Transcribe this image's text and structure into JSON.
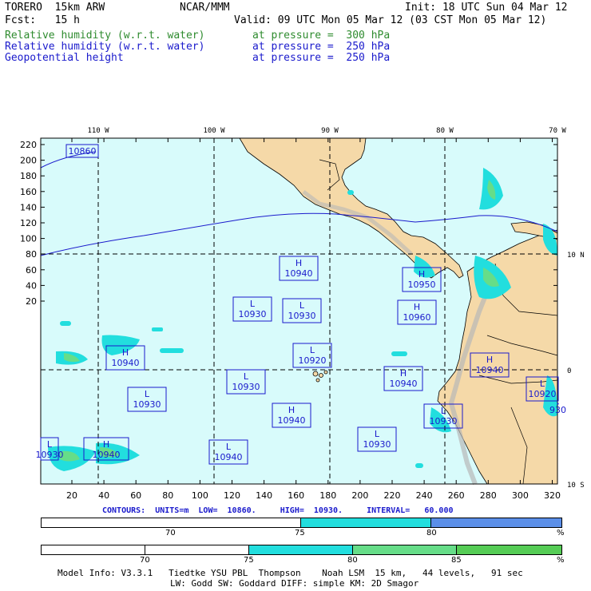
{
  "header": {
    "left1": "TORERO  15km ARW",
    "center1": "NCAR/MMM",
    "right1": "Init: 18 UTC Sun 04 Mar 12",
    "left2": "Fcst:   15 h",
    "right2": "Valid: 09 UTC Mon 05 Mar 12 (03 CST Mon 05 Mar 12)",
    "fields": [
      {
        "name": "Relative humidity (w.r.t. water)",
        "level": "at pressure =  300 hPa",
        "color": "#2e8b2e"
      },
      {
        "name": "Relative humidity (w.r.t. water)",
        "level": "at pressure =  250 hPa",
        "color": "#1a1acc"
      },
      {
        "name": "Geopotential height",
        "level": "at pressure =  250 hPa",
        "color": "#1a1acc"
      }
    ]
  },
  "map": {
    "top_lon_labels": [
      "110 W",
      "100 W",
      "90 W",
      "80 W",
      "70 W"
    ],
    "right_lat_labels": [
      "10 N",
      "0",
      "10 S"
    ],
    "y_ticks": [
      "220",
      "200",
      "180",
      "160",
      "140",
      "120",
      "100",
      "80",
      "60",
      "40",
      "20"
    ],
    "x_ticks": [
      "20",
      "40",
      "60",
      "80",
      "100",
      "120",
      "140",
      "160",
      "180",
      "200",
      "220",
      "240",
      "260",
      "280",
      "300",
      "320"
    ],
    "centers": [
      {
        "type": "",
        "value": "10860"
      },
      {
        "type": "H",
        "value": "10940"
      },
      {
        "type": "H",
        "value": "10940"
      },
      {
        "type": "L",
        "value": "10930"
      },
      {
        "type": "H",
        "value": "10950"
      },
      {
        "type": "H",
        "value": "10960"
      },
      {
        "type": "H",
        "value": "10940"
      },
      {
        "type": "L",
        "value": "10930"
      },
      {
        "type": "L",
        "value": "10930"
      },
      {
        "type": "L",
        "value": "10920"
      },
      {
        "type": "H",
        "value": "10940"
      },
      {
        "type": "L",
        "value": "10930"
      },
      {
        "type": "L",
        "value": "10930"
      },
      {
        "type": "H",
        "value": "10940"
      },
      {
        "type": "L",
        "value": "10930"
      },
      {
        "type": "L",
        "value": "10930"
      },
      {
        "type": "L",
        "value": "10940"
      },
      {
        "type": "H",
        "value": "10940"
      },
      {
        "type": "L",
        "value": "10920"
      },
      {
        "type": "",
        "value": "930"
      }
    ]
  },
  "contours_text": "CONTOURS:  UNITS=m  LOW=  10860.     HIGH=  10930.     INTERVAL=   60.000",
  "colorbar1": {
    "labels": [
      "70",
      "75",
      "80",
      "%"
    ]
  },
  "colorbar2": {
    "labels": [
      "70",
      "75",
      "80",
      "85",
      "%"
    ]
  },
  "model_info_1": "Model Info: V3.3.1   Tiedtke YSU PBL  Thompson    Noah LSM  15 km,   44 levels,   91 sec",
  "model_info_2": "LW: Godd SW: Goddard DIFF: simple KM: 2D Smagor",
  "colors": {
    "ocean": "#d8fbfb",
    "land": "#f5d9a8",
    "rh_cyan": "#22dede",
    "rh_green": "#66dd88",
    "rh_blue": "#5b8fe8",
    "contour": "#1a1acc"
  }
}
